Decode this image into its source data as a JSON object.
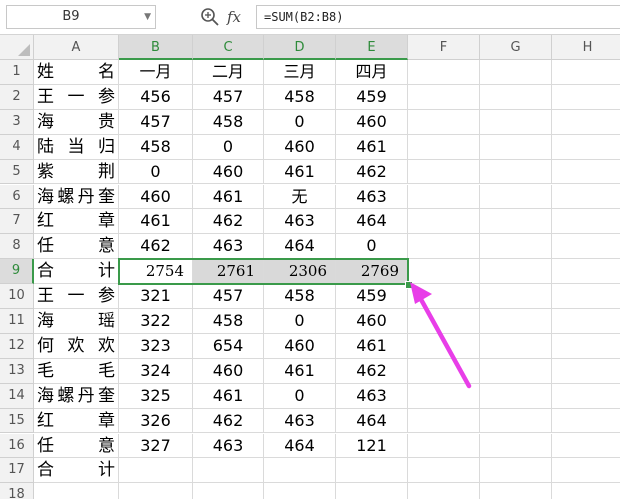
{
  "formula_bar": {
    "name_box": "B9",
    "fx_label": "fx",
    "formula": "=SUM(B2:B8)"
  },
  "columns": [
    "A",
    "B",
    "C",
    "D",
    "E",
    "F",
    "G",
    "H"
  ],
  "rows": [
    {
      "num": "1",
      "name": "姓名",
      "values": [
        "一月",
        "二月",
        "三月",
        "四月"
      ]
    },
    {
      "num": "2",
      "name": "王一参",
      "values": [
        "456",
        "457",
        "458",
        "459"
      ]
    },
    {
      "num": "3",
      "name": "海贵",
      "values": [
        "457",
        "458",
        "0",
        "460"
      ]
    },
    {
      "num": "4",
      "name": "陆当归",
      "values": [
        "458",
        "0",
        "460",
        "461"
      ]
    },
    {
      "num": "5",
      "name": "紫荆",
      "values": [
        "0",
        "460",
        "461",
        "462"
      ]
    },
    {
      "num": "6",
      "name": "海螺丹奎",
      "values": [
        "460",
        "461",
        "无",
        "463"
      ]
    },
    {
      "num": "7",
      "name": "红章",
      "values": [
        "461",
        "462",
        "463",
        "464"
      ]
    },
    {
      "num": "8",
      "name": "任意",
      "values": [
        "462",
        "463",
        "464",
        "0"
      ]
    },
    {
      "num": "9",
      "name": "合计",
      "values": [
        "2754",
        "2761",
        "2306",
        "2769"
      ]
    },
    {
      "num": "10",
      "name": "王一参",
      "values": [
        "321",
        "457",
        "458",
        "459"
      ]
    },
    {
      "num": "11",
      "name": "海瑶",
      "values": [
        "322",
        "458",
        "0",
        "460"
      ]
    },
    {
      "num": "12",
      "name": "何欢欢",
      "values": [
        "323",
        "654",
        "460",
        "461"
      ]
    },
    {
      "num": "13",
      "name": "毛毛",
      "values": [
        "324",
        "460",
        "461",
        "462"
      ]
    },
    {
      "num": "14",
      "name": "海螺丹奎",
      "values": [
        "325",
        "461",
        "0",
        "463"
      ]
    },
    {
      "num": "15",
      "name": "红章",
      "values": [
        "326",
        "462",
        "463",
        "464"
      ]
    },
    {
      "num": "16",
      "name": "任意",
      "values": [
        "327",
        "463",
        "464",
        "121"
      ]
    },
    {
      "num": "17",
      "name": "合计",
      "values": [
        "",
        "",
        "",
        ""
      ]
    },
    {
      "num": "18",
      "name": "",
      "values": [
        "",
        "",
        "",
        ""
      ]
    }
  ],
  "colors": {
    "selection": "#3a9a4a",
    "annotation_arrow": "#e83ee8",
    "selected_range_fill": "#d9d9d9"
  }
}
